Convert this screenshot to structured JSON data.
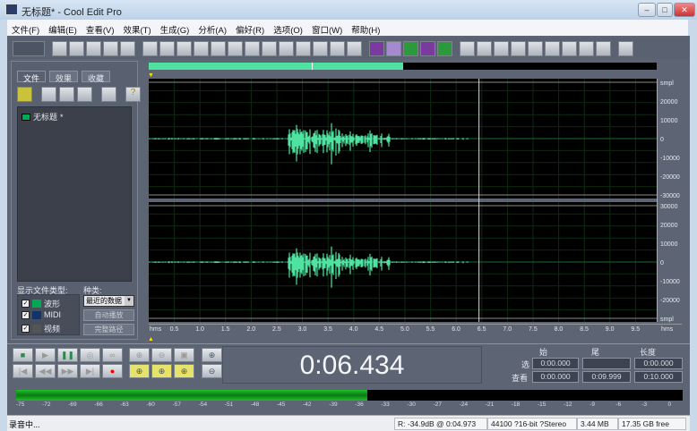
{
  "window": {
    "title": "无标题* - Cool Edit Pro",
    "minimize": "–",
    "maximize": "□",
    "close": "✕"
  },
  "menu": [
    "文件(F)",
    "编辑(E)",
    "查看(V)",
    "效果(T)",
    "生成(G)",
    "分析(A)",
    "偏好(R)",
    "选项(O)",
    "窗口(W)",
    "帮助(H)"
  ],
  "toolbar": {
    "buttons": [
      "multitrack-toggle",
      "new",
      "open",
      "save",
      "save-as",
      "close-file",
      "undo",
      "redo",
      "repeat",
      "copy",
      "paste",
      "cut",
      "mix-paste",
      "trim",
      "delete",
      "snap",
      "zoom-select",
      "spectral",
      "info",
      "mono-left",
      "mono-right",
      "stereo",
      "view-waveform",
      "view-spectral",
      "view-markers",
      "play",
      "zoom",
      "cue",
      "cd",
      "mixer",
      "blank",
      "scripts",
      "favorites",
      "help"
    ]
  },
  "left_panel": {
    "tabs": [
      "文件",
      "效果",
      "收藏"
    ],
    "files": [
      {
        "name": "无标题",
        "modified": "*"
      }
    ],
    "show_types_label": "显示文件类型:",
    "sort_label": "种类:",
    "types": [
      {
        "label": "波形",
        "checked": true
      },
      {
        "label": "MIDI",
        "checked": true
      },
      {
        "label": "视频",
        "checked": true
      }
    ],
    "sort_value": "最近的数据",
    "btn_auto_play": "自动播放",
    "btn_full_path": "完整路径"
  },
  "overview": {
    "visible_fraction": 0.5
  },
  "scale": {
    "ch1": [
      "smpl",
      "20000",
      "10000",
      "0",
      "-10000",
      "-20000",
      "-30000"
    ],
    "ch2": [
      "30000",
      "20000",
      "10000",
      "0",
      "-10000",
      "-20000",
      "smpl"
    ]
  },
  "ruler": {
    "unit": "hms",
    "ticks": [
      "0.5",
      "1.0",
      "1.5",
      "2.0",
      "2.5",
      "3.0",
      "3.5",
      "4.0",
      "4.5",
      "5.0",
      "5.5",
      "6.0",
      "6.5",
      "7.0",
      "7.5",
      "8.0",
      "8.5",
      "9.0",
      "9.5"
    ]
  },
  "cursor_seconds": 6.434,
  "time_display": "0:06.434",
  "selection": {
    "col_begin": "始",
    "col_end": "尾",
    "col_length": "长度",
    "row_sel": "选",
    "row_view": "查看",
    "sel_begin": "0:00.000",
    "sel_end": "",
    "sel_length": "0:00.000",
    "view_begin": "0:00.000",
    "view_end": "0:09.999",
    "view_length": "0:10.000"
  },
  "meter": {
    "ticks": [
      "-75",
      "-72",
      "-69",
      "-66",
      "-63",
      "-60",
      "-57",
      "-54",
      "-51",
      "-48",
      "-45",
      "-42",
      "-39",
      "-36",
      "-33",
      "-30",
      "-27",
      "-24",
      "-21",
      "-18",
      "-15",
      "-12",
      "-9",
      "-6",
      "-3",
      "0"
    ],
    "level_db": -34.9,
    "color": "#1fbf2a"
  },
  "status": {
    "state": "录音中...",
    "peak": "R: -34.9dB @  0:04.973",
    "format": "44100 ?16-bit ?Stereo",
    "size": "3.44 MB",
    "free": "17.35 GB free"
  },
  "colors": {
    "waveform": "#4fe2a0",
    "background": "#000000"
  }
}
